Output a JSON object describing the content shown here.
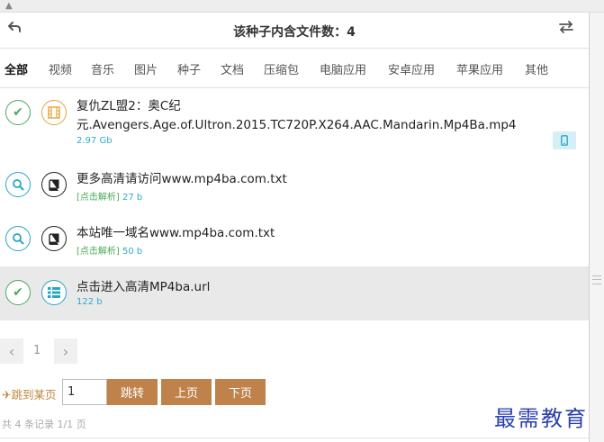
{
  "header": {
    "title": "该种子内含文件数：4"
  },
  "tabs": [
    {
      "label": "全部",
      "active": true
    },
    {
      "label": "视频"
    },
    {
      "label": "音乐"
    },
    {
      "label": "图片"
    },
    {
      "label": "种子"
    },
    {
      "label": "文档"
    },
    {
      "label": "压缩包"
    },
    {
      "label": "电脑应用"
    },
    {
      "label": "安卓应用"
    },
    {
      "label": "苹果应用"
    },
    {
      "label": "其他"
    }
  ],
  "files": [
    {
      "name_line1": "复仇ZL盟2：奥C纪",
      "name_line2": "元.Avengers.Age.of.Ultron.2015.TC720P.X264.AAC.Mandarin.Mp4Ba.mp4",
      "size": "2.97 Gb",
      "left_icon": "check-icon",
      "type_icon": "film-icon"
    },
    {
      "name_line1": "更多高清请访问www.mp4ba.com.txt",
      "parse_label": "[点击解析]",
      "size": "27 b",
      "left_icon": "search-icon",
      "type_icon": "book-icon"
    },
    {
      "name_line1": "本站唯一域名www.mp4ba.com.txt",
      "parse_label": "[点击解析]",
      "size": "50 b",
      "left_icon": "search-icon",
      "type_icon": "book-icon"
    },
    {
      "name_line1": "点击进入高清MP4ba.url",
      "size": "122 b",
      "left_icon": "check-icon",
      "type_icon": "list-icon"
    }
  ],
  "pager": {
    "current_page": "1"
  },
  "jump": {
    "label": "跳到某页",
    "input_value": "1",
    "go_label": "跳转",
    "prev_label": "上页",
    "next_label": "下页"
  },
  "summary": "共 4 条记录 1/1 页",
  "watermark": "最需教育",
  "colors": {
    "accent_brown": "#be824a",
    "link_blue": "#2bacc9",
    "green": "#4aaa5a"
  }
}
